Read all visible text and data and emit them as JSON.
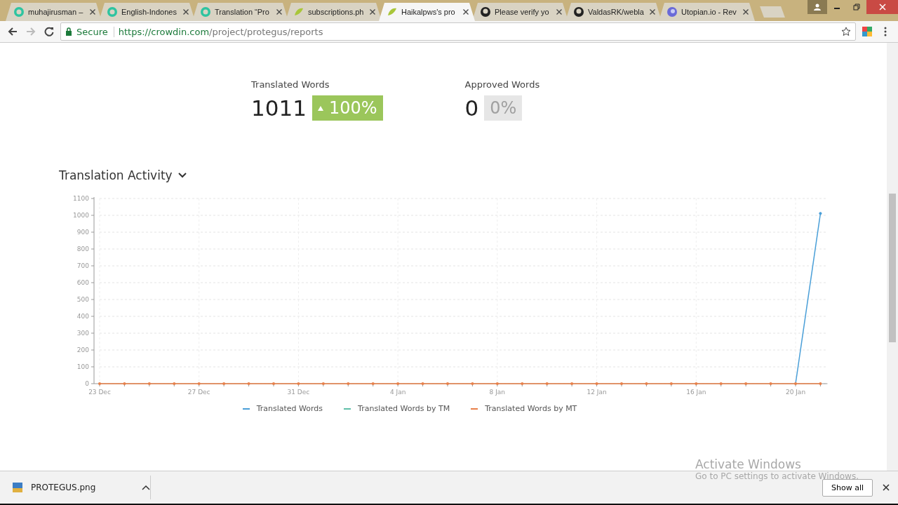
{
  "browser": {
    "tabs": [
      {
        "title": "muhajirusman –",
        "kind": "crowdin",
        "selected": false
      },
      {
        "title": "English-Indones",
        "kind": "crowdin",
        "selected": false
      },
      {
        "title": "Translation “Pro",
        "kind": "crowdin",
        "selected": false
      },
      {
        "title": "subscriptions.ph",
        "kind": "leaf",
        "selected": false
      },
      {
        "title": "Haikalpws's pro",
        "kind": "leaf",
        "selected": true
      },
      {
        "title": "Please verify yo",
        "kind": "github",
        "selected": false
      },
      {
        "title": "ValdasRK/webla",
        "kind": "github",
        "selected": false
      },
      {
        "title": "Utopian.io - Rev",
        "kind": "utopian",
        "selected": false
      }
    ],
    "secure_label": "Secure",
    "url_host": "https://crowdin.com",
    "url_path": "/project/protegus/reports"
  },
  "stats": [
    {
      "label": "Translated Words",
      "value": "1011",
      "change": "100%",
      "kind": "up"
    },
    {
      "label": "Approved Words",
      "value": "0",
      "change": "0%",
      "kind": "flat"
    }
  ],
  "activity": {
    "title": "Translation Activity",
    "chart_data": {
      "type": "line",
      "grid": true,
      "categories": [
        "23 Dec",
        null,
        null,
        null,
        "27 Dec",
        null,
        null,
        null,
        "31 Dec",
        null,
        null,
        null,
        "4 Jan",
        null,
        null,
        null,
        "8 Jan",
        null,
        null,
        null,
        "12 Jan",
        null,
        null,
        null,
        "16 Jan",
        null,
        null,
        null,
        "20 Jan",
        null
      ],
      "ylim": [
        0,
        1100
      ],
      "yticks": [
        0,
        100,
        200,
        300,
        400,
        500,
        600,
        700,
        800,
        900,
        1000,
        1100
      ],
      "series": [
        {
          "name": "Translated Words",
          "color": "#4a9fd8",
          "values": [
            null,
            null,
            null,
            null,
            null,
            null,
            null,
            null,
            null,
            null,
            null,
            null,
            null,
            null,
            null,
            null,
            null,
            null,
            null,
            null,
            null,
            null,
            null,
            null,
            null,
            null,
            null,
            null,
            0,
            1011
          ]
        },
        {
          "name": "Translated Words by TM",
          "color": "#5fbfa8",
          "values": [
            null,
            null,
            null,
            null,
            null,
            null,
            null,
            null,
            null,
            null,
            null,
            null,
            null,
            null,
            null,
            null,
            null,
            null,
            null,
            null,
            null,
            null,
            null,
            null,
            null,
            null,
            null,
            null,
            null,
            null
          ]
        },
        {
          "name": "Translated Words by MT",
          "color": "#e8804a",
          "values": [
            0,
            0,
            0,
            0,
            0,
            0,
            0,
            0,
            0,
            0,
            0,
            0,
            0,
            0,
            0,
            0,
            0,
            0,
            0,
            0,
            0,
            0,
            0,
            0,
            0,
            0,
            0,
            0,
            0,
            0
          ]
        }
      ]
    }
  },
  "windows_notice": {
    "title": "Activate Windows",
    "text": "Go to PC settings to activate Windows."
  },
  "downloads": {
    "file": "PROTEGUS.png",
    "show_all": "Show all"
  }
}
